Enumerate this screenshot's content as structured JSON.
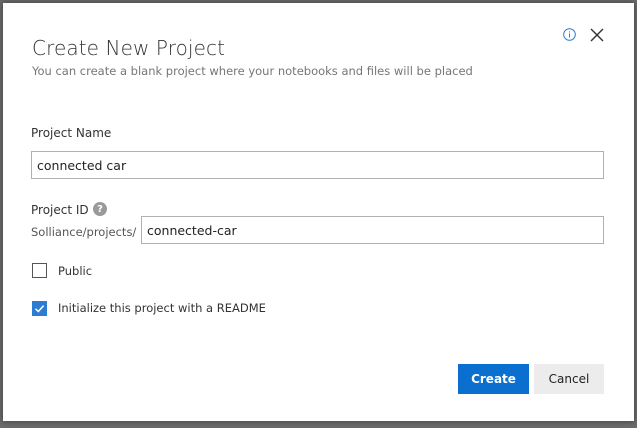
{
  "dialog": {
    "title": "Create New Project",
    "subtitle": "You can create a blank project where your notebooks and files will be placed"
  },
  "icons": {
    "info": "info-icon",
    "close": "close-icon",
    "help": "help-icon",
    "check": "checkmark-icon"
  },
  "form": {
    "project_name": {
      "label": "Project Name",
      "value": "connected car"
    },
    "project_id": {
      "label": "Project ID",
      "help_glyph": "?",
      "prefix": "Solliance/projects/",
      "value": "connected-car"
    },
    "public": {
      "label": "Public",
      "checked": false
    },
    "readme": {
      "label": "Initialize this project with a README",
      "checked": true
    }
  },
  "buttons": {
    "create_label": "Create",
    "cancel_label": "Cancel"
  },
  "colors": {
    "accent": "#0a6fcf",
    "checkbox_checked": "#2b7cd3",
    "overlay": "#6b6b6b"
  }
}
